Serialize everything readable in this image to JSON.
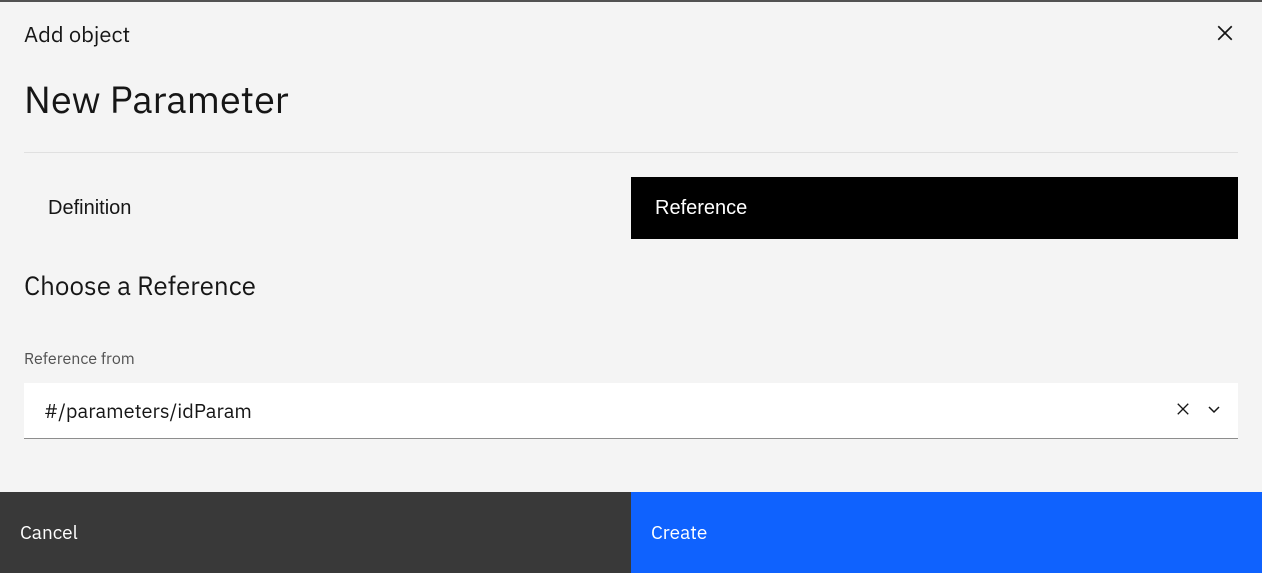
{
  "dialog": {
    "supertitle": "Add object",
    "title": "New Parameter",
    "tabs": {
      "definition": "Definition",
      "reference": "Reference"
    },
    "section_title": "Choose a Reference",
    "field": {
      "label": "Reference from",
      "value": "#/parameters/idParam"
    }
  },
  "footer": {
    "cancel": "Cancel",
    "create": "Create"
  }
}
